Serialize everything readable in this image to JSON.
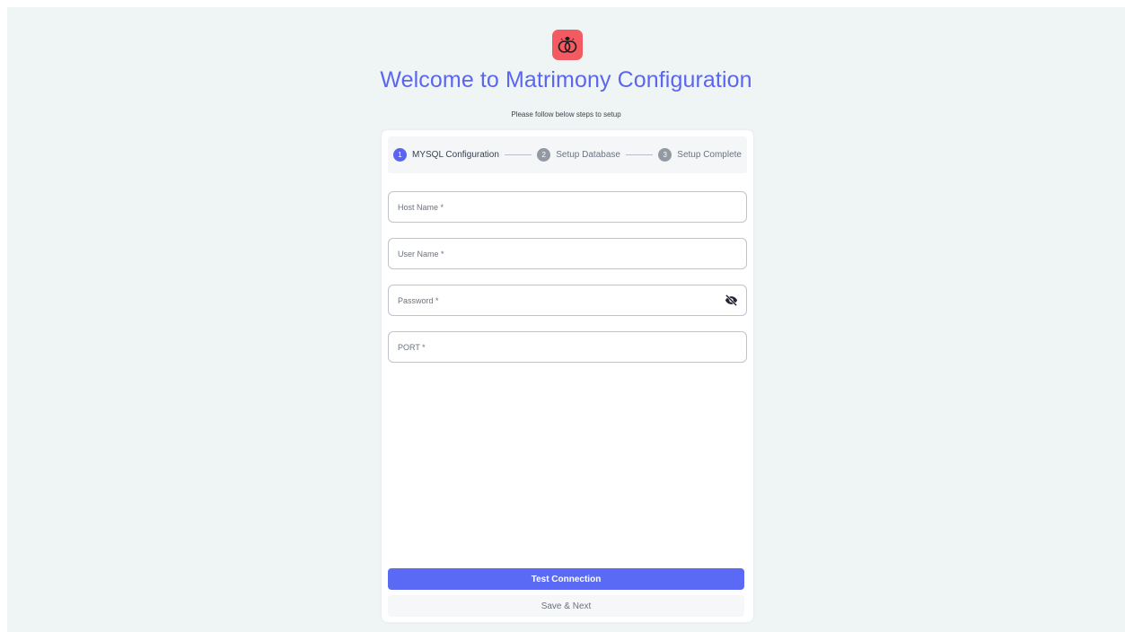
{
  "app": {
    "logo_icon": "wedding-rings-icon",
    "title": "Welcome to Matrimony Configuration",
    "subtitle": "Please follow below steps to setup"
  },
  "stepper": {
    "steps": [
      {
        "number": "1",
        "label": "MYSQL Configuration",
        "active": true
      },
      {
        "number": "2",
        "label": "Setup Database",
        "active": false
      },
      {
        "number": "3",
        "label": "Setup Complete",
        "active": false
      }
    ]
  },
  "form": {
    "host_name": {
      "placeholder": "Host Name *",
      "value": ""
    },
    "user_name": {
      "placeholder": "User Name *",
      "value": ""
    },
    "password": {
      "placeholder": "Password *",
      "value": "",
      "toggle_icon": "eye-off-icon"
    },
    "port": {
      "placeholder": "PORT *",
      "value": ""
    }
  },
  "actions": {
    "test_connection": "Test Connection",
    "save_next": "Save & Next"
  },
  "colors": {
    "accent": "#5a63f2",
    "logo_bg": "#f45a62",
    "page_bg": "#eff4f4"
  }
}
